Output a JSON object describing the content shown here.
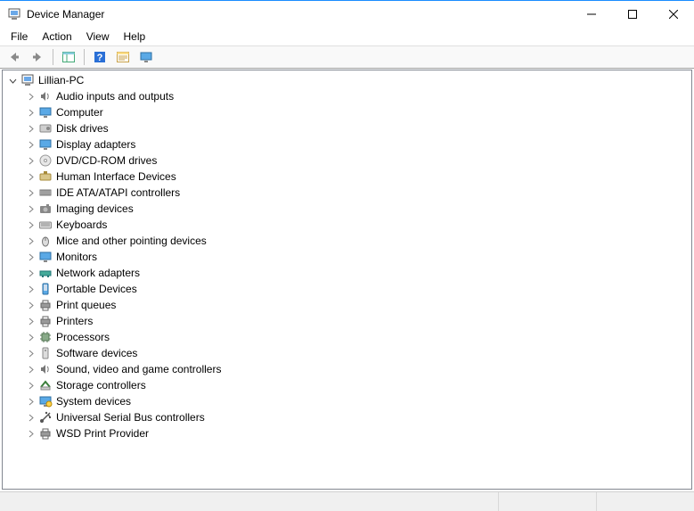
{
  "window": {
    "title": "Device Manager"
  },
  "menu": {
    "file": "File",
    "action": "Action",
    "view": "View",
    "help": "Help"
  },
  "toolbar": {
    "back": "back",
    "forward": "forward",
    "show_hide": "show-hide-console-tree",
    "help": "help",
    "properties": "properties",
    "monitor": "scan-hardware"
  },
  "tree": {
    "root": {
      "label": "Lillian-PC",
      "expanded": true
    },
    "children": [
      {
        "label": "Audio inputs and outputs",
        "icon": "speaker"
      },
      {
        "label": "Computer",
        "icon": "monitor"
      },
      {
        "label": "Disk drives",
        "icon": "disk"
      },
      {
        "label": "Display adapters",
        "icon": "monitor"
      },
      {
        "label": "DVD/CD-ROM drives",
        "icon": "cd"
      },
      {
        "label": "Human Interface Devices",
        "icon": "hid"
      },
      {
        "label": "IDE ATA/ATAPI controllers",
        "icon": "ide"
      },
      {
        "label": "Imaging devices",
        "icon": "camera"
      },
      {
        "label": "Keyboards",
        "icon": "keyboard"
      },
      {
        "label": "Mice and other pointing devices",
        "icon": "mouse"
      },
      {
        "label": "Monitors",
        "icon": "monitor"
      },
      {
        "label": "Network adapters",
        "icon": "network"
      },
      {
        "label": "Portable Devices",
        "icon": "portable"
      },
      {
        "label": "Print queues",
        "icon": "printer"
      },
      {
        "label": "Printers",
        "icon": "printer"
      },
      {
        "label": "Processors",
        "icon": "cpu"
      },
      {
        "label": "Software devices",
        "icon": "software"
      },
      {
        "label": "Sound, video and game controllers",
        "icon": "speaker"
      },
      {
        "label": "Storage controllers",
        "icon": "storage"
      },
      {
        "label": "System devices",
        "icon": "system"
      },
      {
        "label": "Universal Serial Bus controllers",
        "icon": "usb"
      },
      {
        "label": "WSD Print Provider",
        "icon": "printer"
      }
    ]
  }
}
